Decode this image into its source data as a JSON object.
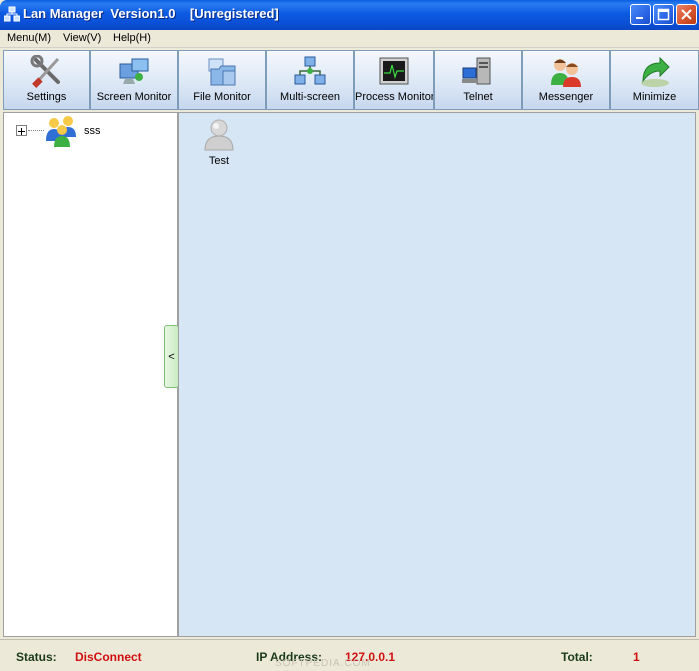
{
  "window": {
    "title": "Lan Manager  Version1.0    [Unregistered]"
  },
  "menu": {
    "items": [
      {
        "label": "Menu(M)"
      },
      {
        "label": "View(V)"
      },
      {
        "label": "Help(H)"
      }
    ]
  },
  "toolbar": {
    "buttons": [
      {
        "label": "Settings",
        "icon": "settings-icon"
      },
      {
        "label": "Screen Monitor",
        "icon": "screen-monitor-icon"
      },
      {
        "label": "File Monitor",
        "icon": "file-monitor-icon"
      },
      {
        "label": "Multi-screen",
        "icon": "multi-screen-icon"
      },
      {
        "label": "Process Monitor",
        "icon": "process-monitor-icon"
      },
      {
        "label": "Telnet",
        "icon": "telnet-icon"
      },
      {
        "label": "Messenger",
        "icon": "messenger-icon"
      },
      {
        "label": "Minimize",
        "icon": "minimize-arrow-icon"
      }
    ]
  },
  "tree": {
    "groups": [
      {
        "label": "sss",
        "icon": "user-group-icon"
      }
    ]
  },
  "panel": {
    "collapse_glyph": "<"
  },
  "hosts": [
    {
      "label": "Test",
      "icon": "user-offline-icon"
    }
  ],
  "status": {
    "status_label": "Status:",
    "status_value": "DisConnect",
    "ip_label": "IP Address:",
    "ip_value": "127.0.0.1",
    "total_label": "Total:",
    "total_value": "1",
    "watermark": "SOFTPEDIA.COM"
  },
  "colors": {
    "titlebar": "#0a4fd6",
    "status_value": "#d01010",
    "content_bg": "#d6e6f5"
  }
}
